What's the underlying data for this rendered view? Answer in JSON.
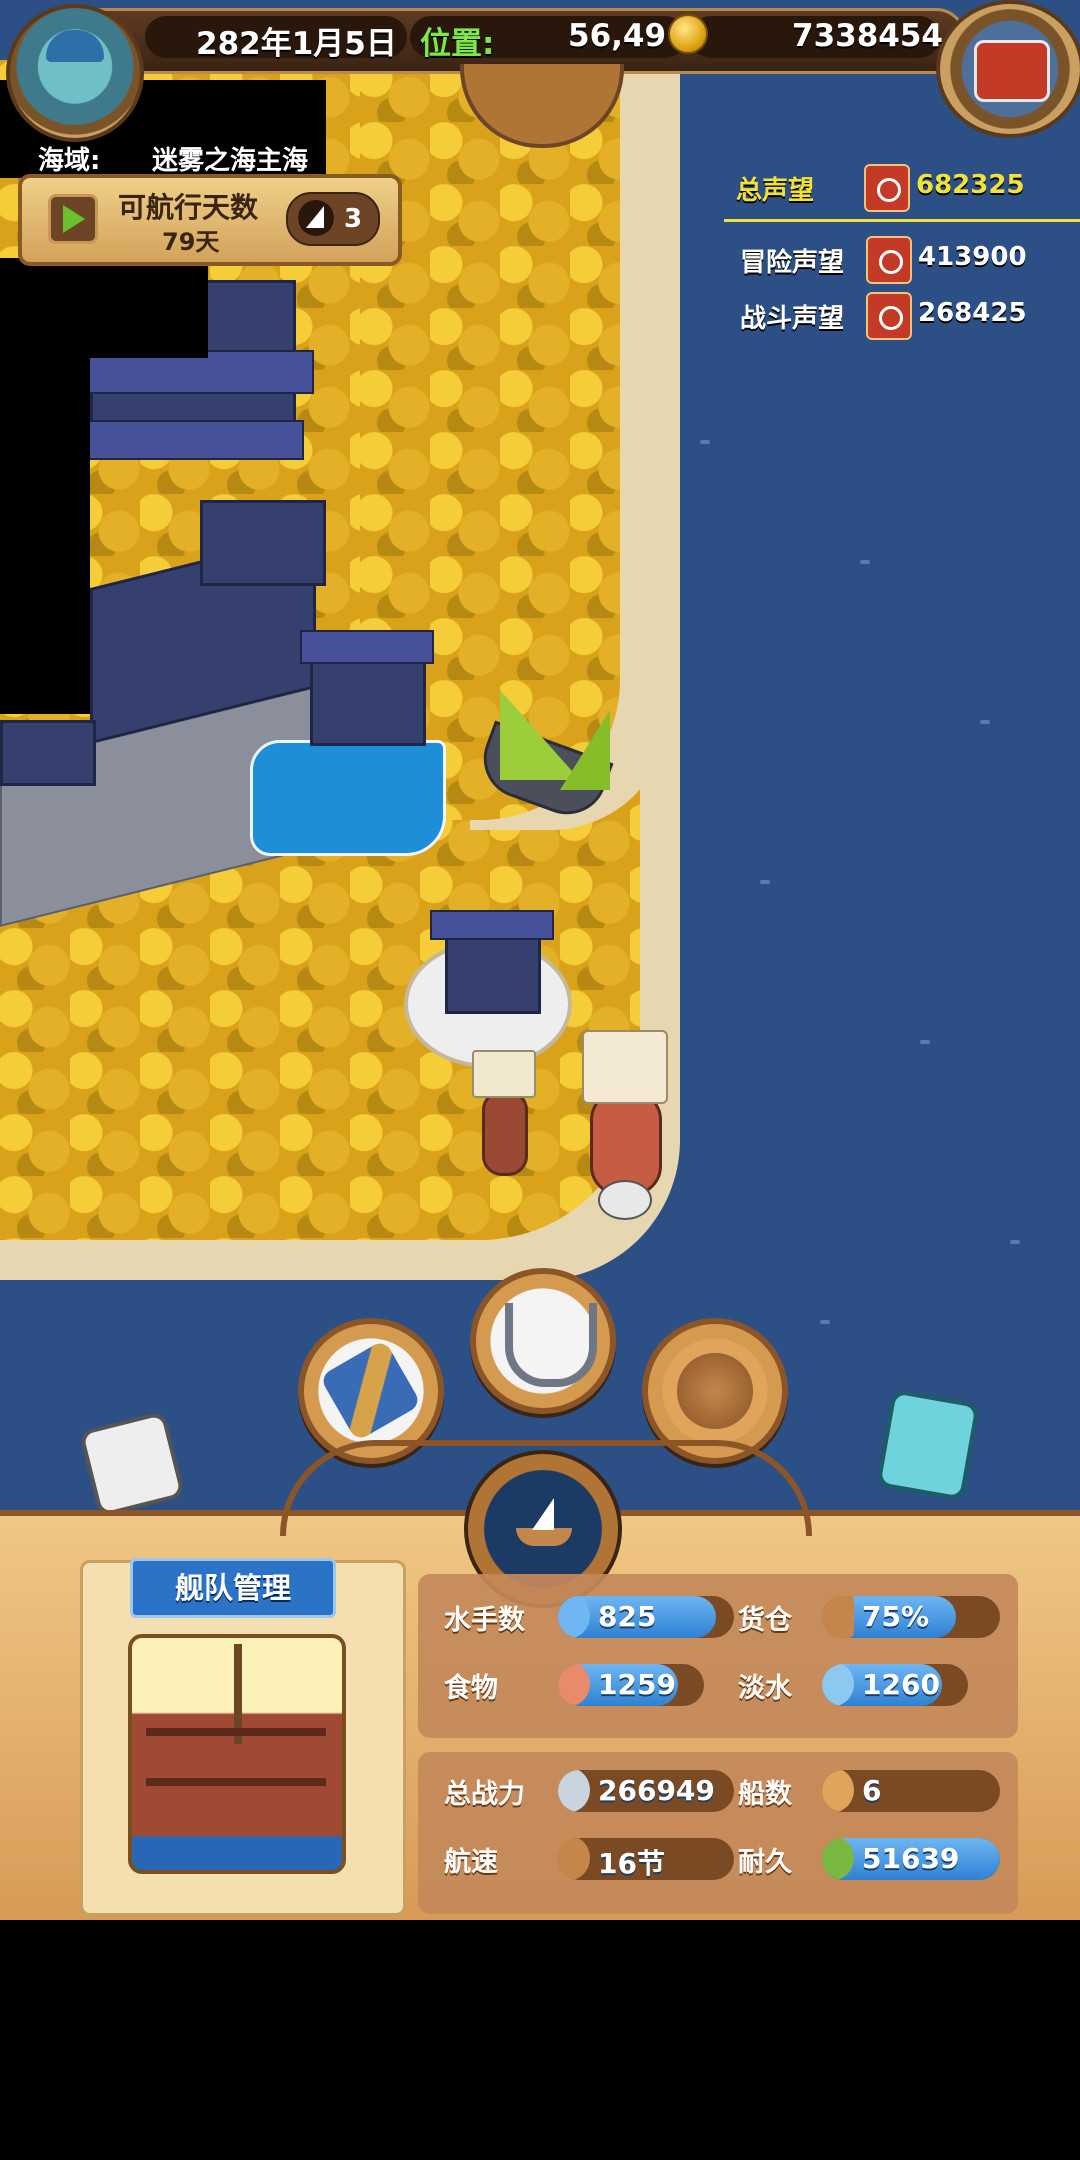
{
  "header": {
    "date": "282年1月5日",
    "position_label": "位置:",
    "position_value": "56,49",
    "gold": "7338454"
  },
  "sea_area": {
    "label": "海域:",
    "name": "迷雾之海主海"
  },
  "voyage": {
    "title": "可航行天数",
    "days": "79天",
    "ship_count": "3"
  },
  "reputation": {
    "total_label": "总声望",
    "total_value": "682325",
    "adventure_label": "冒险声望",
    "adventure_value": "413900",
    "battle_label": "战斗声望",
    "battle_value": "268425",
    "colors": {
      "total": "#f0e23a",
      "other": "#ffffff"
    }
  },
  "actions": {
    "telescope": "telescope-icon",
    "anchor": "anchor-icon",
    "world_map": "world-map-icon",
    "ship": "ship-icon"
  },
  "fleet": {
    "title": "舰队管理",
    "stats": {
      "sailors_label": "水手数",
      "sailors_value": "825",
      "sailors_fill": 0.9,
      "cargo_label": "货仓",
      "cargo_value": "75%",
      "cargo_fill": 0.75,
      "food_label": "食物",
      "food_value": "1259",
      "food_fill": 0.82,
      "water_label": "淡水",
      "water_value": "1260",
      "water_fill": 0.82,
      "power_label": "总战力",
      "power_value": "266949",
      "ships_label": "船数",
      "ships_value": "6",
      "speed_label": "航速",
      "speed_value": "16节",
      "durability_label": "耐久",
      "durability_value": "51639",
      "durability_fill": 1.0
    }
  }
}
